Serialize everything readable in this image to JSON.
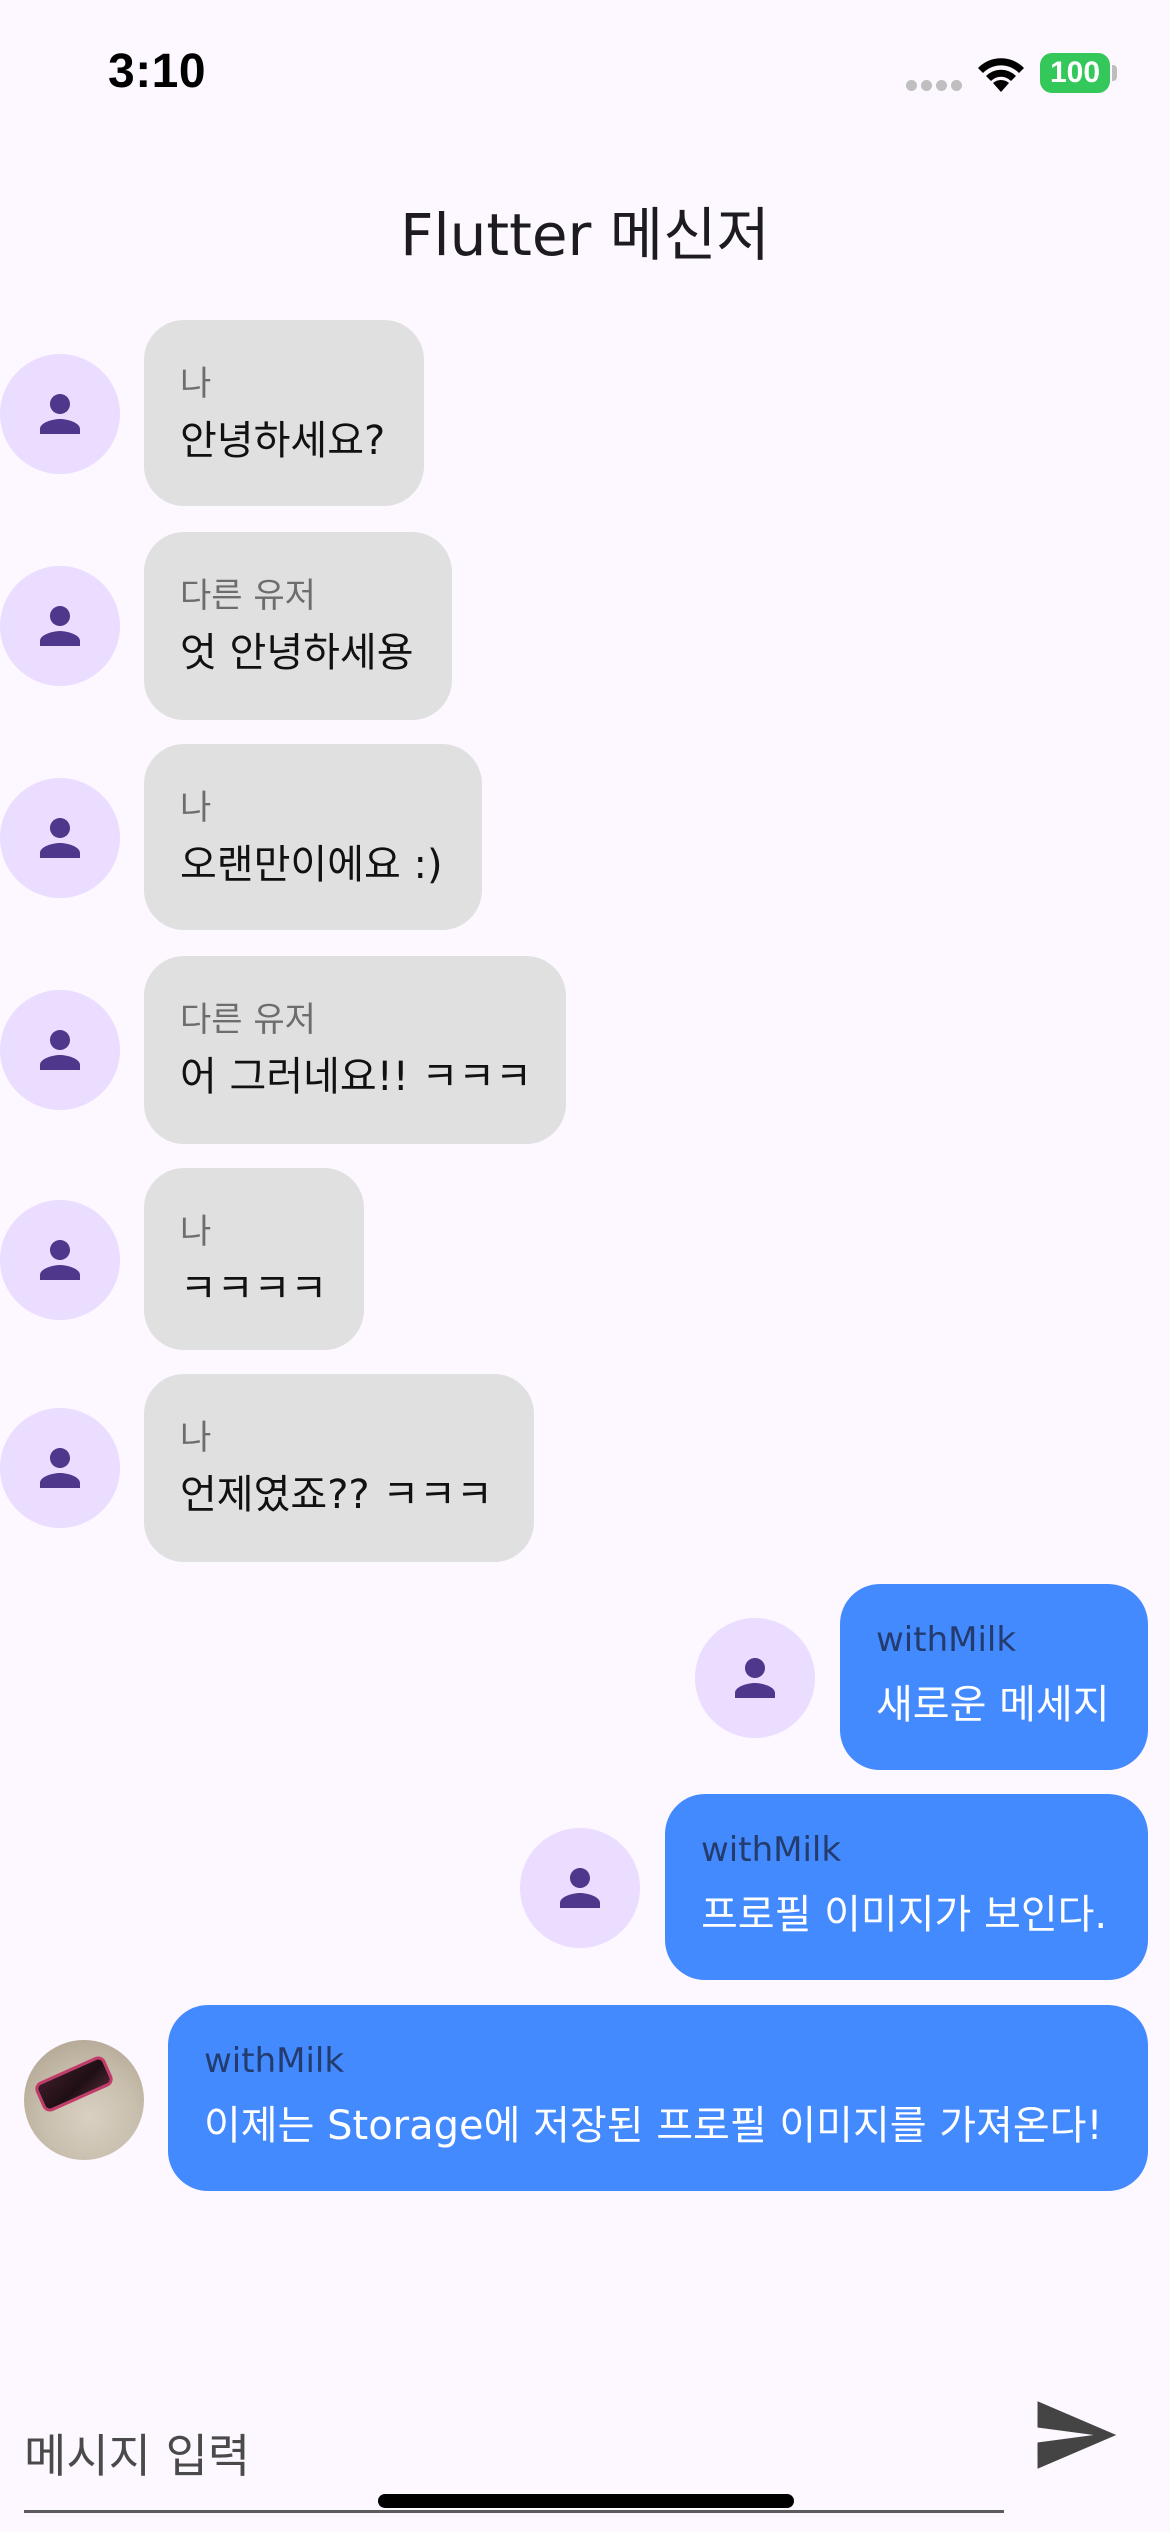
{
  "status_bar": {
    "time": "3:10",
    "battery": "100",
    "battery_color": "#34c759"
  },
  "app_bar": {
    "title": "Flutter 메신저"
  },
  "messages": [
    {
      "sender": "나",
      "text": "안녕하세요?",
      "side": "left",
      "avatar": "person-icon"
    },
    {
      "sender": "다른 유저",
      "text": "엇 안녕하세용",
      "side": "left",
      "avatar": "person-icon"
    },
    {
      "sender": "나",
      "text": "오랜만이에요 :)",
      "side": "left",
      "avatar": "person-icon"
    },
    {
      "sender": "다른 유저",
      "text": "어 그러네요!! ㅋㅋㅋ",
      "side": "left",
      "avatar": "person-icon"
    },
    {
      "sender": "나",
      "text": "ㅋㅋㅋㅋ",
      "side": "left",
      "avatar": "person-icon"
    },
    {
      "sender": "나",
      "text": "언제였죠?? ㅋㅋㅋ",
      "side": "left",
      "avatar": "person-icon"
    },
    {
      "sender": "withMilk",
      "text": "새로운 메세지",
      "side": "right",
      "avatar": "person-icon"
    },
    {
      "sender": "withMilk",
      "text": "프로필 이미지가 보인다.",
      "side": "right",
      "avatar": "person-icon"
    },
    {
      "sender": "withMilk",
      "text": "이제는 Storage에 저장된 프로필 이미지를 가져온다!",
      "side": "right",
      "avatar": "profile-photo"
    }
  ],
  "colors": {
    "background": "#fdf7ff",
    "other_bubble": "#e0e0e0",
    "my_bubble": "#448aff",
    "avatar_bg": "#eaddff",
    "avatar_icon": "#4f378b"
  },
  "composer": {
    "placeholder": "메시지 입력",
    "send_icon": "send-icon"
  }
}
